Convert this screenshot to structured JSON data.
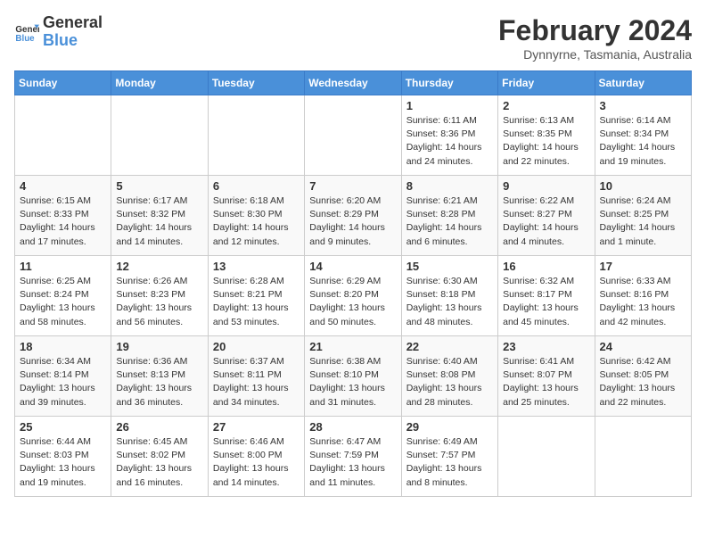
{
  "logo": {
    "general": "General",
    "blue": "Blue"
  },
  "title": "February 2024",
  "subtitle": "Dynnyrne, Tasmania, Australia",
  "days_of_week": [
    "Sunday",
    "Monday",
    "Tuesday",
    "Wednesday",
    "Thursday",
    "Friday",
    "Saturday"
  ],
  "weeks": [
    [
      {
        "day": "",
        "info": ""
      },
      {
        "day": "",
        "info": ""
      },
      {
        "day": "",
        "info": ""
      },
      {
        "day": "",
        "info": ""
      },
      {
        "day": "1",
        "info": "Sunrise: 6:11 AM\nSunset: 8:36 PM\nDaylight: 14 hours and 24 minutes."
      },
      {
        "day": "2",
        "info": "Sunrise: 6:13 AM\nSunset: 8:35 PM\nDaylight: 14 hours and 22 minutes."
      },
      {
        "day": "3",
        "info": "Sunrise: 6:14 AM\nSunset: 8:34 PM\nDaylight: 14 hours and 19 minutes."
      }
    ],
    [
      {
        "day": "4",
        "info": "Sunrise: 6:15 AM\nSunset: 8:33 PM\nDaylight: 14 hours and 17 minutes."
      },
      {
        "day": "5",
        "info": "Sunrise: 6:17 AM\nSunset: 8:32 PM\nDaylight: 14 hours and 14 minutes."
      },
      {
        "day": "6",
        "info": "Sunrise: 6:18 AM\nSunset: 8:30 PM\nDaylight: 14 hours and 12 minutes."
      },
      {
        "day": "7",
        "info": "Sunrise: 6:20 AM\nSunset: 8:29 PM\nDaylight: 14 hours and 9 minutes."
      },
      {
        "day": "8",
        "info": "Sunrise: 6:21 AM\nSunset: 8:28 PM\nDaylight: 14 hours and 6 minutes."
      },
      {
        "day": "9",
        "info": "Sunrise: 6:22 AM\nSunset: 8:27 PM\nDaylight: 14 hours and 4 minutes."
      },
      {
        "day": "10",
        "info": "Sunrise: 6:24 AM\nSunset: 8:25 PM\nDaylight: 14 hours and 1 minute."
      }
    ],
    [
      {
        "day": "11",
        "info": "Sunrise: 6:25 AM\nSunset: 8:24 PM\nDaylight: 13 hours and 58 minutes."
      },
      {
        "day": "12",
        "info": "Sunrise: 6:26 AM\nSunset: 8:23 PM\nDaylight: 13 hours and 56 minutes."
      },
      {
        "day": "13",
        "info": "Sunrise: 6:28 AM\nSunset: 8:21 PM\nDaylight: 13 hours and 53 minutes."
      },
      {
        "day": "14",
        "info": "Sunrise: 6:29 AM\nSunset: 8:20 PM\nDaylight: 13 hours and 50 minutes."
      },
      {
        "day": "15",
        "info": "Sunrise: 6:30 AM\nSunset: 8:18 PM\nDaylight: 13 hours and 48 minutes."
      },
      {
        "day": "16",
        "info": "Sunrise: 6:32 AM\nSunset: 8:17 PM\nDaylight: 13 hours and 45 minutes."
      },
      {
        "day": "17",
        "info": "Sunrise: 6:33 AM\nSunset: 8:16 PM\nDaylight: 13 hours and 42 minutes."
      }
    ],
    [
      {
        "day": "18",
        "info": "Sunrise: 6:34 AM\nSunset: 8:14 PM\nDaylight: 13 hours and 39 minutes."
      },
      {
        "day": "19",
        "info": "Sunrise: 6:36 AM\nSunset: 8:13 PM\nDaylight: 13 hours and 36 minutes."
      },
      {
        "day": "20",
        "info": "Sunrise: 6:37 AM\nSunset: 8:11 PM\nDaylight: 13 hours and 34 minutes."
      },
      {
        "day": "21",
        "info": "Sunrise: 6:38 AM\nSunset: 8:10 PM\nDaylight: 13 hours and 31 minutes."
      },
      {
        "day": "22",
        "info": "Sunrise: 6:40 AM\nSunset: 8:08 PM\nDaylight: 13 hours and 28 minutes."
      },
      {
        "day": "23",
        "info": "Sunrise: 6:41 AM\nSunset: 8:07 PM\nDaylight: 13 hours and 25 minutes."
      },
      {
        "day": "24",
        "info": "Sunrise: 6:42 AM\nSunset: 8:05 PM\nDaylight: 13 hours and 22 minutes."
      }
    ],
    [
      {
        "day": "25",
        "info": "Sunrise: 6:44 AM\nSunset: 8:03 PM\nDaylight: 13 hours and 19 minutes."
      },
      {
        "day": "26",
        "info": "Sunrise: 6:45 AM\nSunset: 8:02 PM\nDaylight: 13 hours and 16 minutes."
      },
      {
        "day": "27",
        "info": "Sunrise: 6:46 AM\nSunset: 8:00 PM\nDaylight: 13 hours and 14 minutes."
      },
      {
        "day": "28",
        "info": "Sunrise: 6:47 AM\nSunset: 7:59 PM\nDaylight: 13 hours and 11 minutes."
      },
      {
        "day": "29",
        "info": "Sunrise: 6:49 AM\nSunset: 7:57 PM\nDaylight: 13 hours and 8 minutes."
      },
      {
        "day": "",
        "info": ""
      },
      {
        "day": "",
        "info": ""
      }
    ]
  ]
}
